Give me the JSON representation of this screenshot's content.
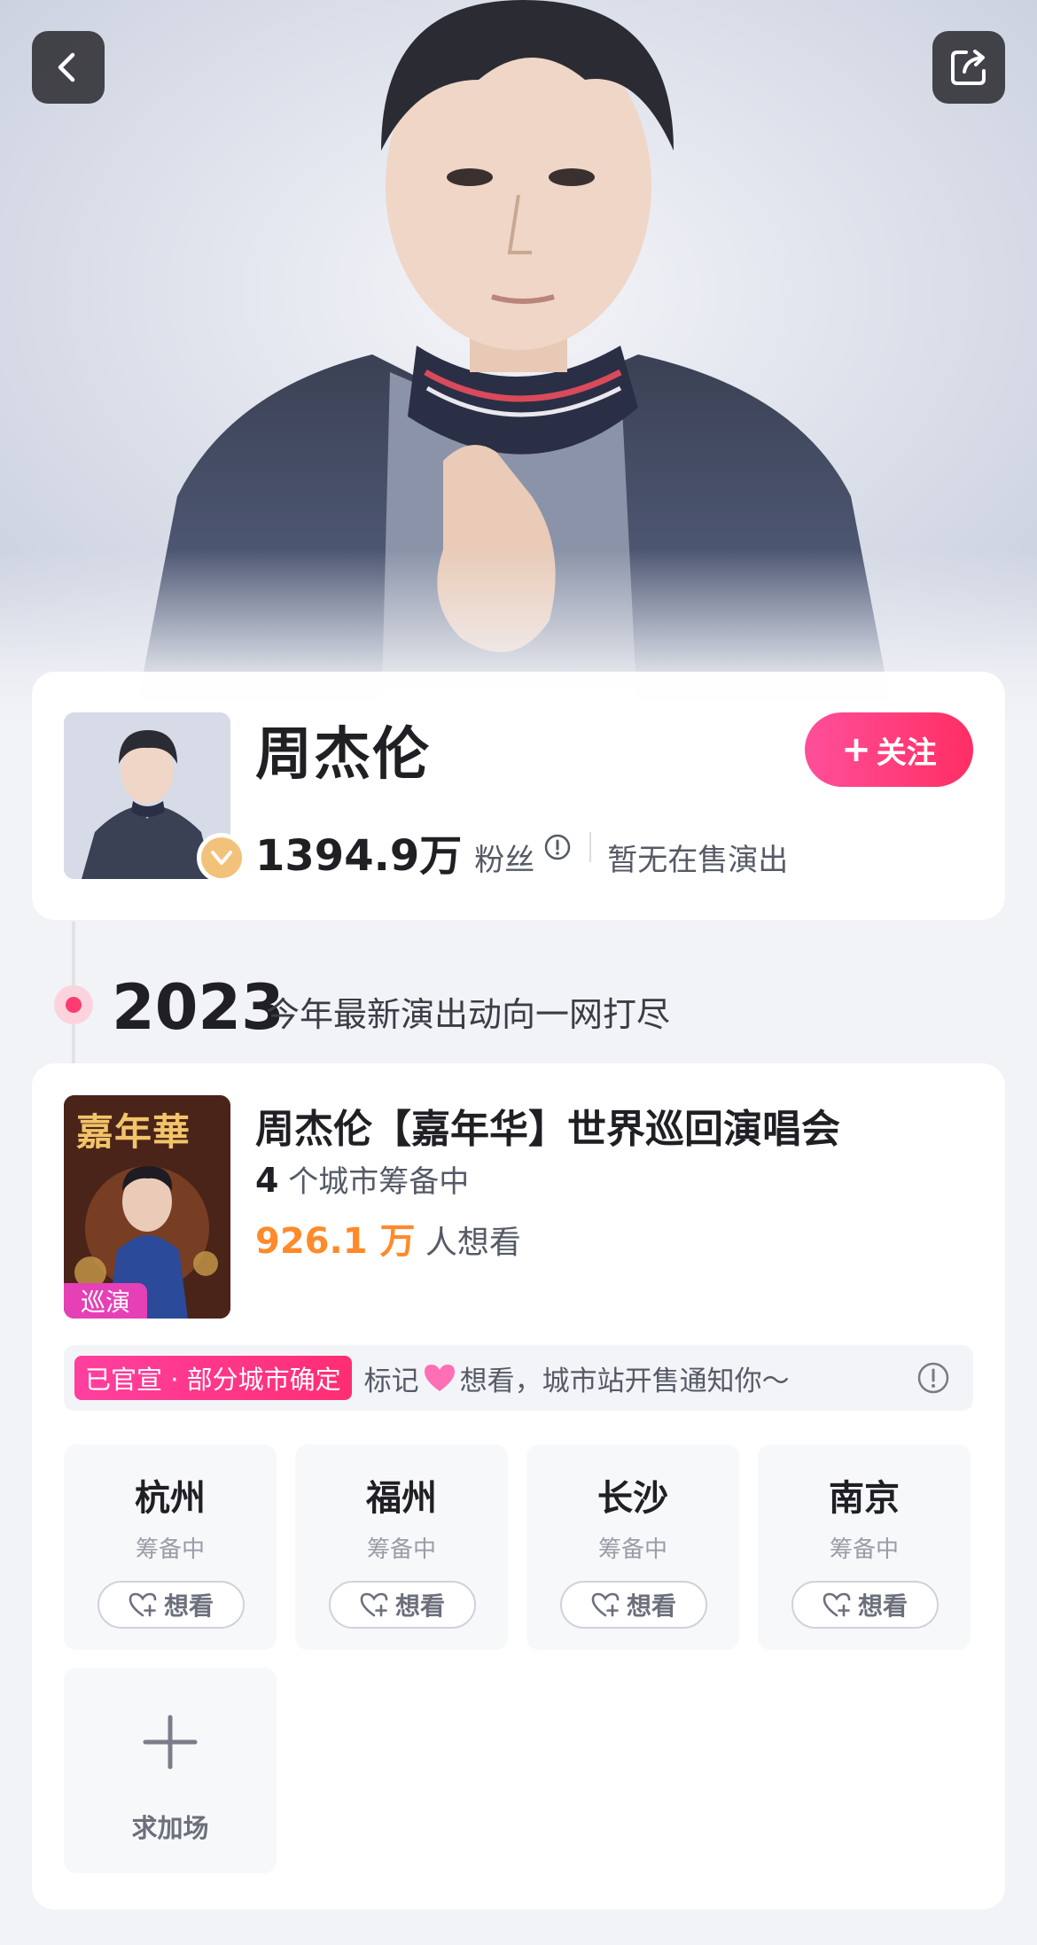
{
  "nav": {
    "back_icon": "chevron-left-icon",
    "share_icon": "share-icon"
  },
  "artist": {
    "name": "周杰伦",
    "follow_label": "关注",
    "fans_count": "1394.9万",
    "fans_label": "粉丝",
    "no_show_text": "暂无在售演出",
    "verified_icon": "verified-badge-icon"
  },
  "timeline": {
    "year": "2023",
    "subtitle": "今年最新演出动向一网打尽"
  },
  "tour": {
    "poster_title": "嘉年華",
    "poster_tag": "巡演",
    "title": "周杰伦【嘉年华】世界巡回演唱会",
    "city_count": "4",
    "city_count_suffix": "个城市筹备中",
    "want_count": "926.1 万",
    "want_suffix": "人想看",
    "notice_tag": "已官宣 · 部分城市确定",
    "notice_prefix": "标记",
    "notice_suffix": "想看，城市站开售通知你～",
    "cities": [
      {
        "name": "杭州",
        "status": "筹备中",
        "want_label": "想看"
      },
      {
        "name": "福州",
        "status": "筹备中",
        "want_label": "想看"
      },
      {
        "name": "长沙",
        "status": "筹备中",
        "want_label": "想看"
      },
      {
        "name": "南京",
        "status": "筹备中",
        "want_label": "想看"
      }
    ],
    "add_show_label": "求加场"
  },
  "colors": {
    "accent_pink": "#ff2e63",
    "want_orange": "#ff8a2a",
    "page_bg": "#f2f3f7"
  }
}
